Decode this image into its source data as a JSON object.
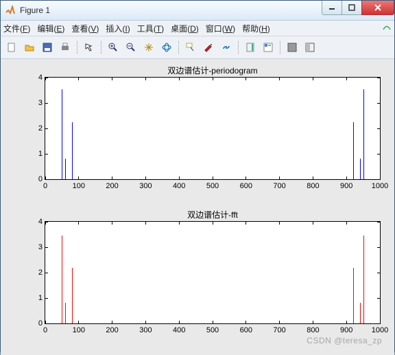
{
  "window": {
    "title": "Figure 1"
  },
  "menubar": {
    "items": [
      {
        "label": "文件",
        "key": "F"
      },
      {
        "label": "编辑",
        "key": "E"
      },
      {
        "label": "查看",
        "key": "V"
      },
      {
        "label": "插入",
        "key": "I"
      },
      {
        "label": "工具",
        "key": "T"
      },
      {
        "label": "桌面",
        "key": "D"
      },
      {
        "label": "窗口",
        "key": "W"
      },
      {
        "label": "帮助",
        "key": "H"
      }
    ]
  },
  "toolbar_icons": [
    "new",
    "open",
    "save",
    "print",
    "sep",
    "arrow",
    "sep",
    "zoom-in",
    "zoom-out",
    "pan",
    "rotate3d",
    "sep",
    "datacursor",
    "brush",
    "link",
    "sep",
    "colorbar",
    "legend",
    "sep",
    "layout-1",
    "layout-2"
  ],
  "chart_data": [
    {
      "type": "stem",
      "title": "双边谱估计-periodogram",
      "color": "#0000ff",
      "xlim": [
        0,
        1000
      ],
      "ylim": [
        0,
        4
      ],
      "xticks": [
        0,
        100,
        200,
        300,
        400,
        500,
        600,
        700,
        800,
        900,
        1000
      ],
      "yticks": [
        0,
        1,
        2,
        3,
        4
      ],
      "x": [
        50,
        60,
        80,
        920,
        940,
        950
      ],
      "y": [
        3.55,
        0.8,
        2.25,
        2.25,
        0.8,
        3.55
      ]
    },
    {
      "type": "stem",
      "title": "双边谱估计-fft",
      "color": "#ff0000",
      "xlim": [
        0,
        1000
      ],
      "ylim": [
        0,
        4
      ],
      "xticks": [
        0,
        100,
        200,
        300,
        400,
        500,
        600,
        700,
        800,
        900,
        1000
      ],
      "yticks": [
        0,
        1,
        2,
        3,
        4
      ],
      "x": [
        50,
        60,
        80,
        920,
        940,
        950
      ],
      "y": [
        3.45,
        0.8,
        2.2,
        2.2,
        0.8,
        3.45
      ]
    }
  ],
  "watermark": "CSDN @teresa_zp"
}
